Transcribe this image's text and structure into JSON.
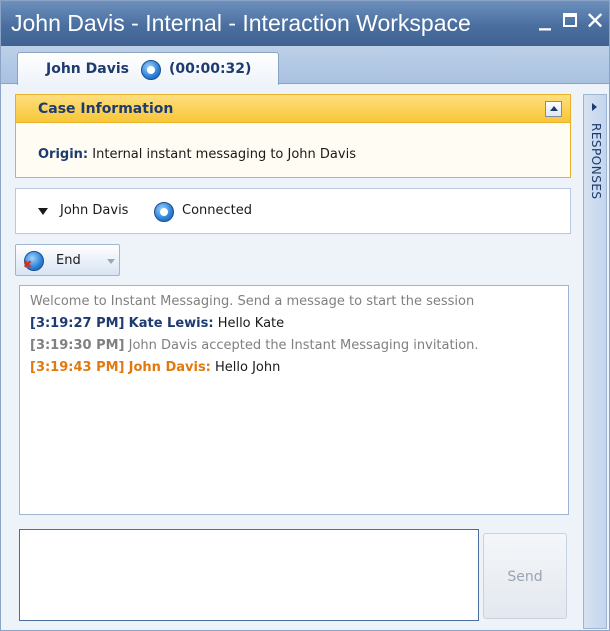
{
  "window": {
    "title": "John Davis - Internal - Interaction Workspace",
    "controls": [
      "minimize-icon",
      "maximize-icon",
      "close-icon"
    ]
  },
  "tab": {
    "name": "John Davis",
    "duration": "(00:00:32)",
    "icon": "chat-bubble-icon"
  },
  "case_information": {
    "header": "Case Information",
    "origin_label": "Origin:",
    "origin_value": "Internal instant messaging to John Davis"
  },
  "responses_panel": {
    "label": "RESPONSES"
  },
  "party": {
    "name": "John Davis",
    "status": "Connected"
  },
  "toolbar": {
    "end_label": "End"
  },
  "transcript": [
    {
      "type": "system",
      "text": "Welcome to Instant Messaging. Send a message to start the session"
    },
    {
      "type": "agent",
      "time": "[3:19:27 PM]",
      "sender": "Kate Lewis:",
      "text": "Hello Kate"
    },
    {
      "type": "system",
      "time": "[3:19:30 PM]",
      "text": "John Davis accepted the Instant Messaging invitation."
    },
    {
      "type": "contact",
      "time": "[3:19:43 PM]",
      "sender": "John Davis:",
      "text": "Hello John"
    }
  ],
  "compose": {
    "value": "",
    "send_label": "Send"
  },
  "colors": {
    "title_bar": "#4a6f9f",
    "case_header": "#f7c638",
    "agent_text": "#1d3b6f",
    "contact_text": "#e07a10",
    "system_text": "#808080"
  }
}
